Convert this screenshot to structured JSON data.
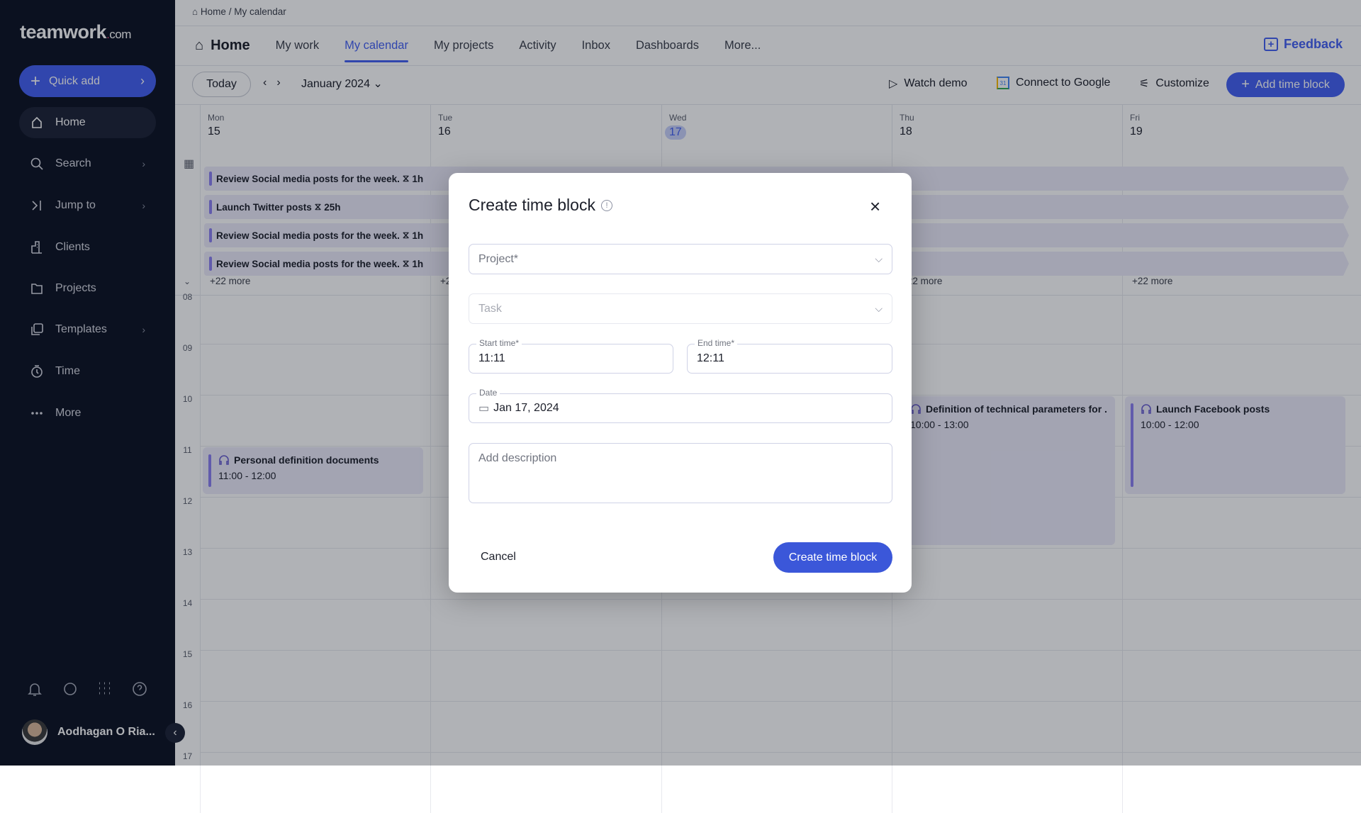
{
  "sidebar": {
    "logo": {
      "main": "teamwork",
      "dot": ".",
      "suffix": "com"
    },
    "quick_add": "Quick add",
    "items": [
      {
        "label": "Home",
        "icon": "home-icon"
      },
      {
        "label": "Search",
        "icon": "search-icon"
      },
      {
        "label": "Jump to",
        "icon": "jump-to-icon"
      },
      {
        "label": "Clients",
        "icon": "clients-icon"
      },
      {
        "label": "Projects",
        "icon": "folder-icon"
      },
      {
        "label": "Templates",
        "icon": "templates-icon"
      },
      {
        "label": "Time",
        "icon": "stopwatch-icon"
      },
      {
        "label": "More",
        "icon": "more-dots-icon"
      }
    ],
    "user": "Aodhagan O Ria..."
  },
  "breadcrumb": {
    "home": "Home",
    "sep": "/",
    "current": "My calendar"
  },
  "tabs": [
    "Home",
    "My work",
    "My calendar",
    "My projects",
    "Activity",
    "Inbox",
    "Dashboards",
    "More..."
  ],
  "feedback": "Feedback",
  "toolbar": {
    "today": "Today",
    "month": "January 2024",
    "watch_demo": "Watch demo",
    "connect": "Connect to Google",
    "customize": "Customize",
    "add_time_block": "Add time block",
    "google_icon_text": "31"
  },
  "days": [
    {
      "name": "Mon",
      "date": "15"
    },
    {
      "name": "Tue",
      "date": "16"
    },
    {
      "name": "Wed",
      "date": "17",
      "current": true
    },
    {
      "name": "Thu",
      "date": "18"
    },
    {
      "name": "Fri",
      "date": "19"
    }
  ],
  "all_day": [
    {
      "title": "Review Social media posts for the week.",
      "duration": "1h"
    },
    {
      "title": "Launch Twitter posts",
      "duration": "25h"
    },
    {
      "title": "Review Social media posts for the week.",
      "duration": "1h"
    },
    {
      "title": "Review Social media posts for the week.",
      "duration": "1h"
    }
  ],
  "more_links": [
    "+22 more",
    "+22 more",
    "+22 more",
    "+22 more",
    "+22 more"
  ],
  "hours": [
    "08",
    "09",
    "10",
    "11",
    "12",
    "13",
    "14",
    "15",
    "16",
    "17"
  ],
  "events": [
    {
      "title": "Personal definition documents",
      "time": "11:00 - 12:00"
    },
    {
      "title": "Definition of technical parameters for ...",
      "time": "10:00 - 13:00"
    },
    {
      "title": "Launch Facebook posts",
      "time": "10:00 - 12:00"
    }
  ],
  "modal": {
    "title": "Create time block",
    "project_placeholder": "Project*",
    "task_placeholder": "Task",
    "start_label": "Start time*",
    "start_value": "11:11",
    "end_label": "End time*",
    "end_value": "12:11",
    "date_label": "Date",
    "date_value": "Jan 17, 2024",
    "description_placeholder": "Add description",
    "cancel": "Cancel",
    "create": "Create time block"
  },
  "colors": {
    "accent": "#4461f2",
    "event_bg": "#ecebfa",
    "event_bar": "#8b7ff0",
    "sidebar_bg": "#0d1222"
  }
}
